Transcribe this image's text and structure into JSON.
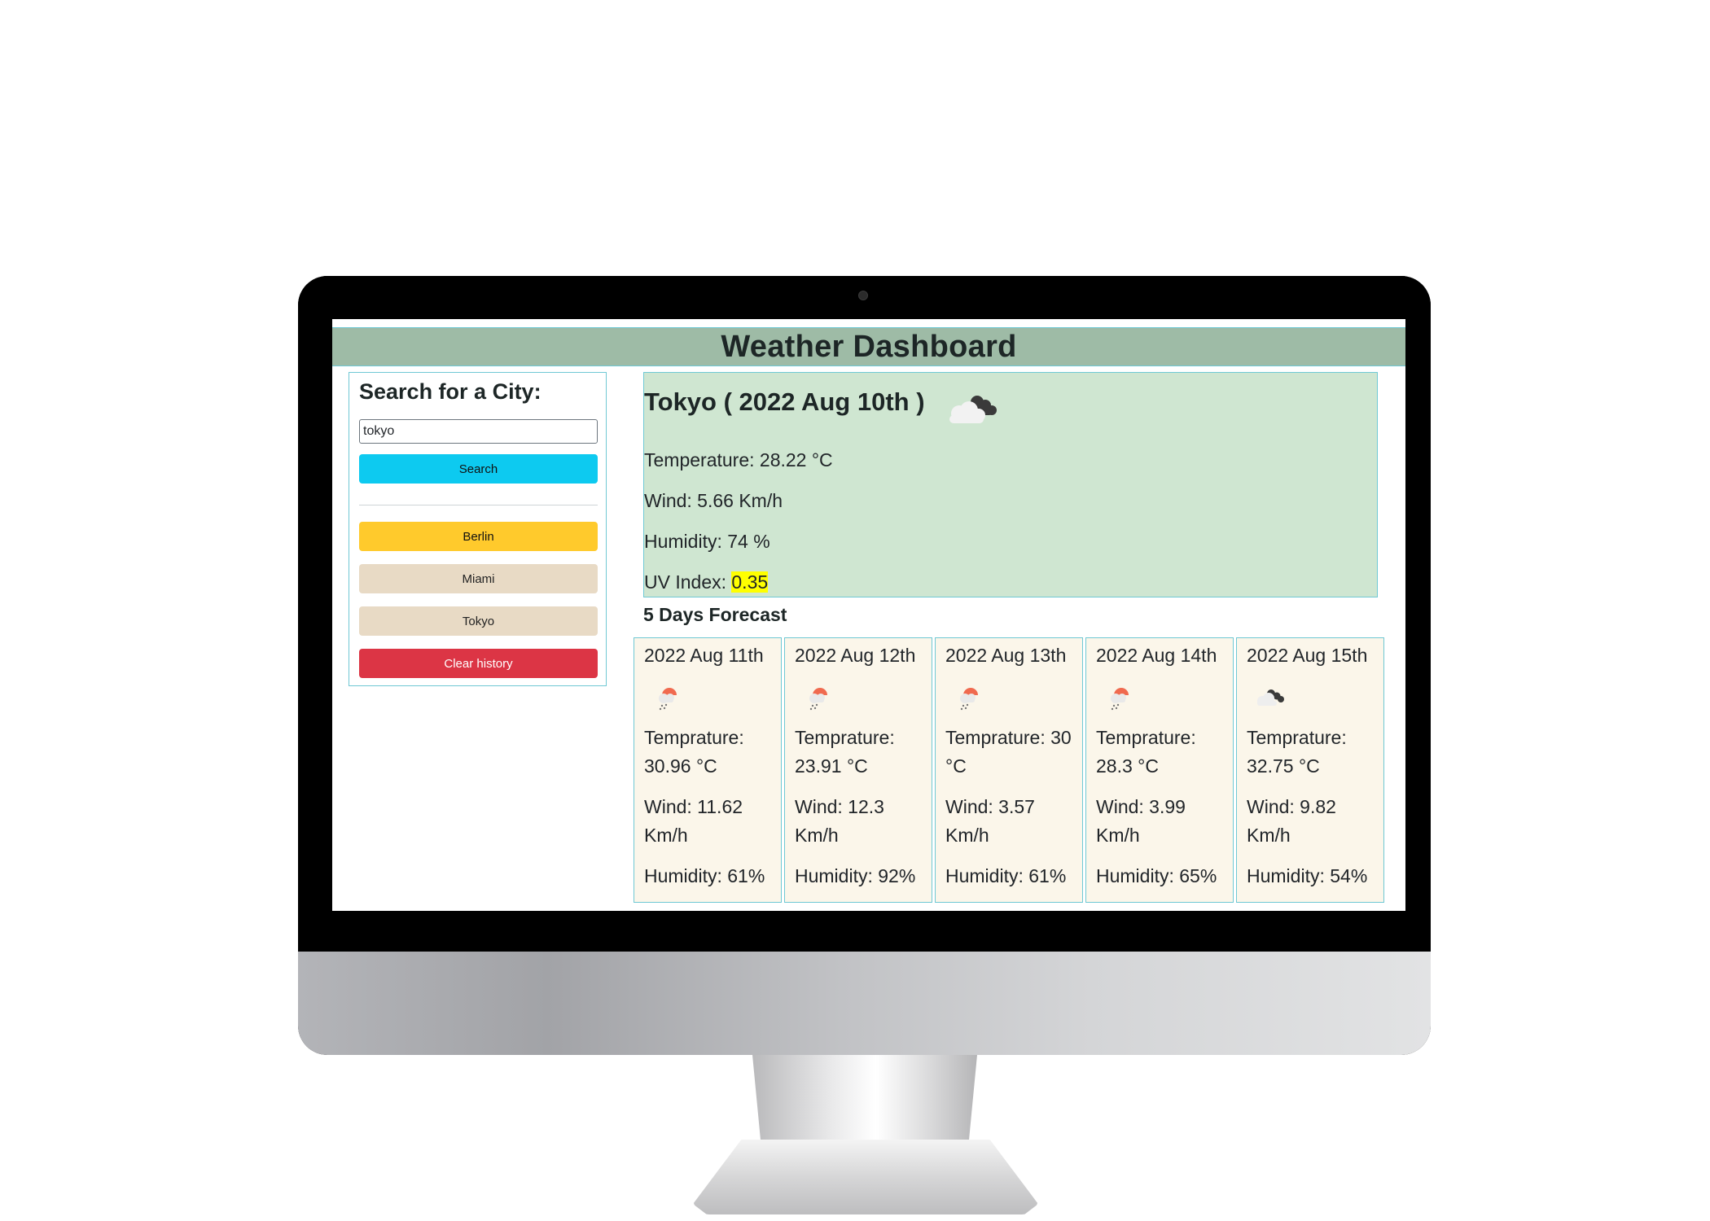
{
  "header": {
    "title": "Weather Dashboard"
  },
  "search": {
    "title": "Search for a City:",
    "input_value": "tokyo",
    "button_label": "Search"
  },
  "history": {
    "items": [
      {
        "label": "Berlin",
        "color": "#ffca2c"
      },
      {
        "label": "Miami",
        "color": "#e8dac5"
      },
      {
        "label": "Tokyo",
        "color": "#e8dac5"
      }
    ],
    "clear_label": "Clear history"
  },
  "current": {
    "title": "Tokyo ( 2022 Aug 10th )",
    "icon": "broken-clouds-icon",
    "temperature": "Temperature: 28.22 °C",
    "wind": "Wind: 5.66 Km/h",
    "humidity": "Humidity: 74 %",
    "uv_label": "UV Index: ",
    "uv_value": "0.35",
    "uv_color": "#ffff00"
  },
  "forecast": {
    "title": "5 Days Forecast",
    "days": [
      {
        "date": "2022 Aug 11th",
        "icon": "light-rain-icon",
        "temp": "Temprature: 30.96 °C",
        "wind": "Wind: 11.62 Km/h",
        "humidity": "Humidity: 61%"
      },
      {
        "date": "2022 Aug 12th",
        "icon": "light-rain-icon",
        "temp": "Temprature: 23.91 °C",
        "wind": "Wind: 12.3 Km/h",
        "humidity": "Humidity: 92%"
      },
      {
        "date": "2022 Aug 13th",
        "icon": "light-rain-icon",
        "temp": "Temprature: 30 °C",
        "wind": "Wind: 3.57 Km/h",
        "humidity": "Humidity: 61%"
      },
      {
        "date": "2022 Aug 14th",
        "icon": "light-rain-icon",
        "temp": "Temprature: 28.3 °C",
        "wind": "Wind: 3.99 Km/h",
        "humidity": "Humidity: 65%"
      },
      {
        "date": "2022 Aug 15th",
        "icon": "broken-clouds-icon",
        "temp": "Temprature: 32.75 °C",
        "wind": "Wind: 9.82 Km/h",
        "humidity": "Humidity: 54%"
      }
    ]
  },
  "colors": {
    "header_bg": "#9ebba6",
    "border": "#6fc8d4",
    "current_bg": "#cfe6d1",
    "card_bg": "#fbf6ea",
    "search_btn": "#0dcaf0",
    "clear_btn": "#dc3545"
  }
}
